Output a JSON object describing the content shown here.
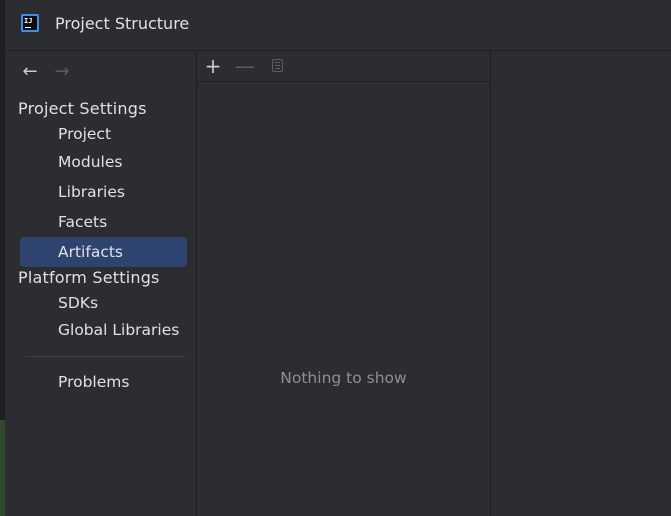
{
  "window": {
    "title": "Project Structure",
    "app_icon": "intellij-idea-icon",
    "app_icon_text": "IJ"
  },
  "navigation": {
    "back_icon": "arrow-left-icon",
    "back_glyph": "←",
    "forward_icon": "arrow-right-icon",
    "forward_glyph": "→"
  },
  "sidebar": {
    "project_settings_header": "Project Settings",
    "project_settings_items": [
      {
        "label": "Project"
      },
      {
        "label": "Modules"
      },
      {
        "label": "Libraries"
      },
      {
        "label": "Facets"
      },
      {
        "label": "Artifacts",
        "selected": true
      }
    ],
    "platform_settings_header": "Platform Settings",
    "platform_settings_items": [
      {
        "label": "SDKs"
      },
      {
        "label": "Global Libraries"
      }
    ],
    "other_items": [
      {
        "label": "Problems"
      }
    ]
  },
  "toolbar": {
    "add_icon": "plus-icon",
    "add_glyph": "+",
    "remove_icon": "minus-icon",
    "remove_glyph": "—",
    "copy_icon": "copy-icon"
  },
  "list": {
    "empty_text": "Nothing to show"
  },
  "colors": {
    "background": "#2b2d30",
    "selection": "#2e436e",
    "text": "#dfe1e5",
    "muted_text": "#8c8f94",
    "disabled_icon": "#5a5d63"
  }
}
